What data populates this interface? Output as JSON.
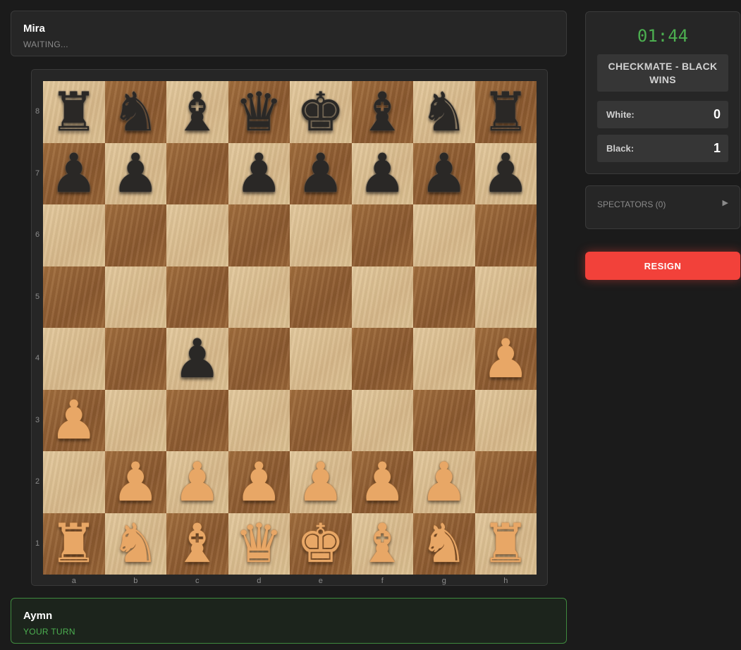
{
  "players": {
    "opponent": {
      "name": "Mira",
      "status": "WAITING..."
    },
    "self": {
      "name": "Aymn",
      "status": "YOUR TURN"
    }
  },
  "board": {
    "files": [
      "a",
      "b",
      "c",
      "d",
      "e",
      "f",
      "g",
      "h"
    ],
    "ranks": [
      "8",
      "7",
      "6",
      "5",
      "4",
      "3",
      "2",
      "1"
    ],
    "rows": [
      [
        "br",
        "bn",
        "bb",
        "bq",
        "bk",
        "bb",
        "bn",
        "br"
      ],
      [
        "bp",
        "bp",
        "",
        "bp",
        "bp",
        "bp",
        "bp",
        "bp"
      ],
      [
        "",
        "",
        "",
        "",
        "",
        "",
        "",
        ""
      ],
      [
        "",
        "",
        "",
        "",
        "",
        "",
        "",
        ""
      ],
      [
        "",
        "",
        "bp",
        "",
        "",
        "",
        "",
        "wp"
      ],
      [
        "wp",
        "",
        "",
        "",
        "",
        "",
        "",
        ""
      ],
      [
        "",
        "wp",
        "wp",
        "wp",
        "wp",
        "wp",
        "wp",
        ""
      ],
      [
        "wr",
        "wn",
        "wb",
        "wq",
        "wk",
        "wb",
        "wn",
        "wr"
      ]
    ],
    "colors": {
      "light": "#e3c99d",
      "dark": "#9a6637",
      "white_piece": "#e8a766",
      "black_piece": "#2a2826"
    }
  },
  "sidebar": {
    "timer": "01:44",
    "game_status": "CHECKMATE - BLACK WINS",
    "scores": [
      {
        "label": "White:",
        "value": "0"
      },
      {
        "label": "Black:",
        "value": "1"
      }
    ],
    "spectators_label": "SPECTATORS (0)",
    "spectators_icon": "play-arrow-icon",
    "resign_label": "RESIGN"
  },
  "colors": {
    "accent_green": "#4caf50",
    "resign_red": "#f2413a"
  }
}
